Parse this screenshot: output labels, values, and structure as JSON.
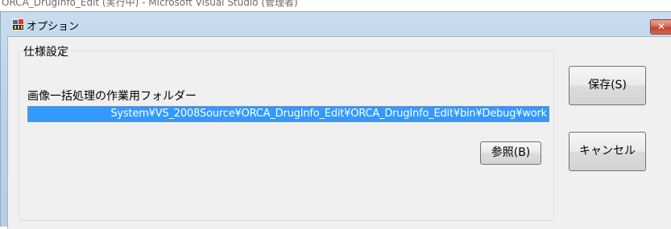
{
  "background_window": {
    "title_fragment": "ORCA_DrugInfo_Edit (実行中) - Microsoft Visual Studio (管理者)"
  },
  "dialog": {
    "title": "オプション",
    "close_glyph": "✕",
    "icon": "app-icon"
  },
  "settings_group": {
    "legend": "仕様設定",
    "folder_label": "画像一括処理の作業用フォルダー",
    "folder_value": "System¥VS_2008Source¥ORCA_DrugInfo_Edit¥ORCA_DrugInfo_Edit¥bin¥Debug¥work",
    "browse_label": "参照(B)"
  },
  "actions": {
    "save_label": "保存(S)",
    "cancel_label": "キャンセル"
  },
  "colors": {
    "selection": "#3399ff",
    "client_bg": "#f0f0f0",
    "close_red": "#c0442b"
  }
}
